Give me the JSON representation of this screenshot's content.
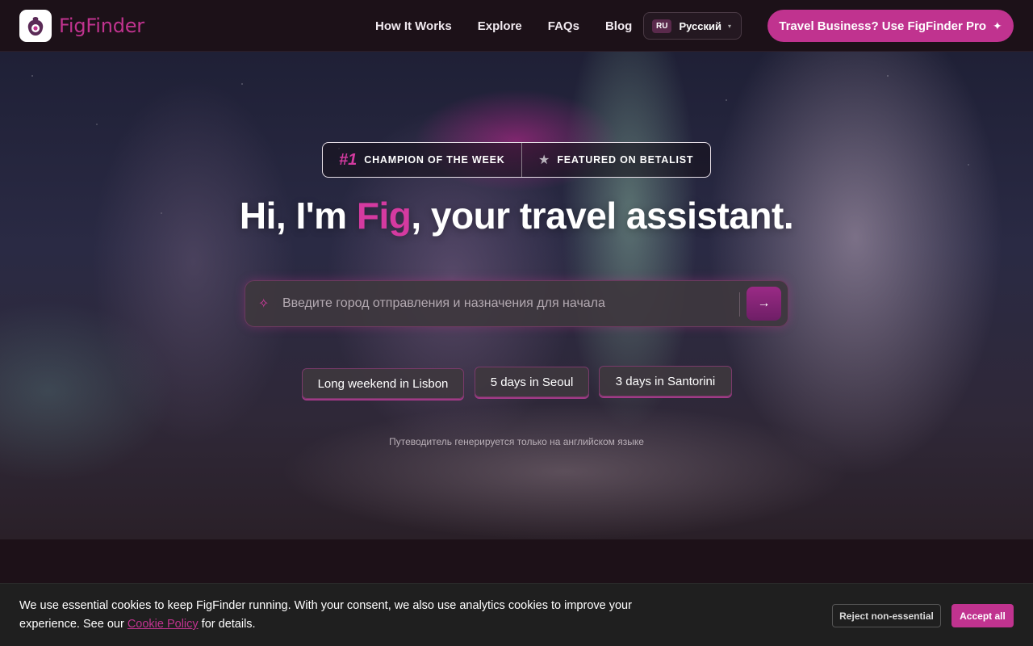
{
  "header": {
    "brand": "FigFinder",
    "nav": [
      "How It Works",
      "Explore",
      "FAQs",
      "Blog"
    ],
    "language": {
      "code": "RU",
      "name": "Русский"
    },
    "pro_button": "Travel Business? Use FigFinder Pro"
  },
  "hero": {
    "badge": {
      "rank": "#1",
      "left_text": "CHAMPION OF THE WEEK",
      "right_text": "FEATURED ON BETALIST"
    },
    "headline": {
      "before": "Hi, I'm ",
      "highlight": "Fig",
      "after": ",  your travel assistant."
    },
    "search": {
      "placeholder": "Введите город отправления и назначения для начала"
    },
    "chips": [
      "Long weekend in Lisbon",
      "5 days in Seoul",
      "3 days in Santorini"
    ],
    "note": "Путеводитель генерируется только на английском языке"
  },
  "cookie": {
    "text_before": "We use essential cookies to keep FigFinder running. With your consent, we also use analytics cookies to improve your experience. See our ",
    "link": "Cookie Policy",
    "text_after": " for details.",
    "reject": "Reject non-essential",
    "accept": "Accept all"
  },
  "colors": {
    "accent": "#c0338f",
    "header_bg": "#1c1118",
    "cookie_bg": "#1f1f1f"
  }
}
